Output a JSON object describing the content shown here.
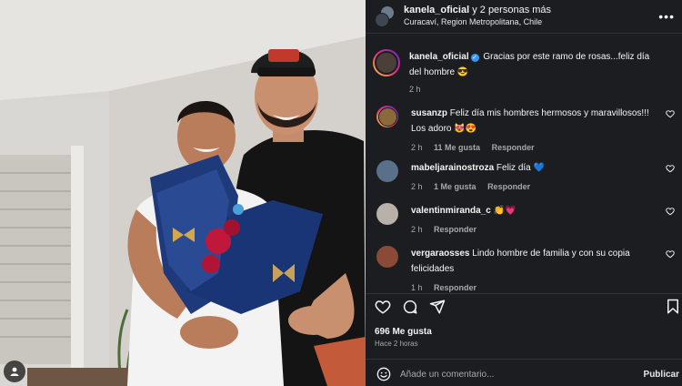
{
  "post_header": {
    "username": "kanela_oficial",
    "coauthors_text": " y 2 personas más",
    "location": "Curacaví, Region Metropolitana, Chile",
    "more_icon": "more-horizontal-icon"
  },
  "caption": {
    "username": "kanela_oficial",
    "verified_icon": "verified-badge-icon",
    "text": " Gracias por este ramo de rosas...feliz día del hombre 😎",
    "time": "2 h"
  },
  "comments": [
    {
      "username": "susanzp",
      "text": " Feliz día mis hombres hermosos y maravillosos!!! Los adoro 😻😍",
      "time": "2 h",
      "likes": "11 Me gusta",
      "reply": "Responder",
      "avatar_color": "#8a6a3a",
      "story_ring": true
    },
    {
      "username": "mabeljarainostroza",
      "text": " Feliz día 💙",
      "time": "2 h",
      "likes": "1 Me gusta",
      "reply": "Responder",
      "avatar_color": "#5a6f8a",
      "story_ring": false
    },
    {
      "username": "valentinmiranda_c",
      "text": " 👏💗",
      "time": "2 h",
      "likes": "",
      "reply": "Responder",
      "avatar_color": "#b8b1aa",
      "story_ring": false
    },
    {
      "username": "vergaraosses",
      "text": " Lindo hombre de familia y con su copia felicidades",
      "time": "1 h",
      "likes": "",
      "reply": "Responder",
      "avatar_color": "#8b4a35",
      "story_ring": false
    }
  ],
  "actions": {
    "like_icon": "heart-icon",
    "comment_icon": "comment-icon",
    "share_icon": "share-icon",
    "save_icon": "bookmark-icon"
  },
  "likes_text": "696 Me gusta",
  "post_time": "Hace 2 horas",
  "comment_box": {
    "emoji_icon": "emoji-icon",
    "placeholder": "Añade un comentario...",
    "publish_label": "Publicar"
  },
  "colors": {
    "panel_bg": "#1b1d21",
    "text_primary": "#f5f5f5",
    "text_secondary": "#a8a8a8",
    "verified_blue": "#3897f0"
  }
}
